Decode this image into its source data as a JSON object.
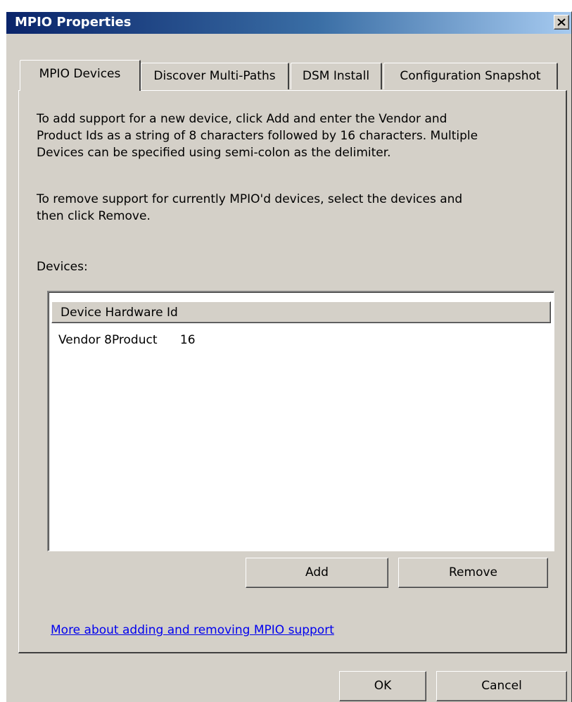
{
  "window": {
    "title": "MPIO Properties"
  },
  "tabs": [
    {
      "label": "MPIO Devices",
      "selected": true
    },
    {
      "label": "Discover Multi-Paths",
      "selected": false
    },
    {
      "label": "DSM Install",
      "selected": false
    },
    {
      "label": "Configuration Snapshot",
      "selected": false
    }
  ],
  "content": {
    "add_paragraph": [
      "To add support for a new device, click Add and enter the Vendor and",
      "Product Ids as a string of 8 characters followed by 16 characters. Multiple",
      "Devices can be specified using semi-colon as the delimiter."
    ],
    "remove_paragraph": [
      "To remove support for currently MPIO'd devices, select the devices and",
      "then click Remove."
    ],
    "devices_label": "Devices:"
  },
  "devices_list": {
    "column_header": "Device Hardware Id",
    "rows": [
      "Vendor 8Product      16"
    ]
  },
  "buttons": {
    "add": "Add",
    "remove": "Remove",
    "ok": "OK",
    "cancel": "Cancel"
  },
  "help_link": "More about adding and removing MPIO support",
  "icons": {
    "close": "close-icon"
  },
  "colors": {
    "dialog_face": "#d4d0c8",
    "title_gradient_start": "#0a246a",
    "title_gradient_end": "#a6caf0",
    "link": "#0000ee"
  }
}
